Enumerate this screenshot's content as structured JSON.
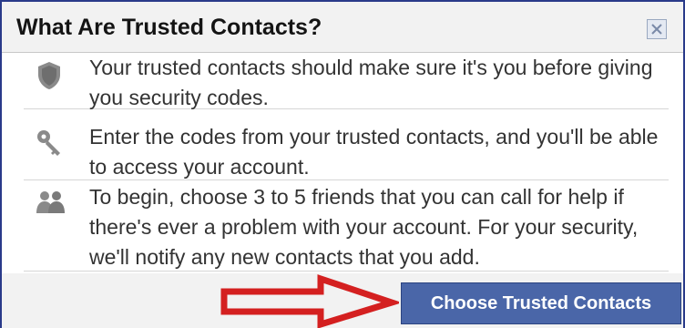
{
  "dialog": {
    "title": "What Are Trusted Contacts?",
    "close_icon": "close-icon"
  },
  "items": [
    {
      "icon": "shield-icon",
      "text": "Your trusted contacts should make sure it's you before giving you security codes."
    },
    {
      "icon": "key-icon",
      "text": "Enter the codes from your trusted contacts, and you'll be able to access your account."
    },
    {
      "icon": "friends-icon",
      "text": "To begin, choose 3 to 5 friends that you can call for help if there's ever a problem with your account. For your security, we'll notify any new contacts that you add."
    }
  ],
  "footer": {
    "button_label": "Choose Trusted Contacts",
    "annotation": "red-arrow"
  },
  "colors": {
    "border": "#2a3a8a",
    "header_bg": "#f2f2f2",
    "button_bg": "#4a66a8",
    "arrow": "#d42020",
    "icon_gray": "#8a8a8a"
  }
}
